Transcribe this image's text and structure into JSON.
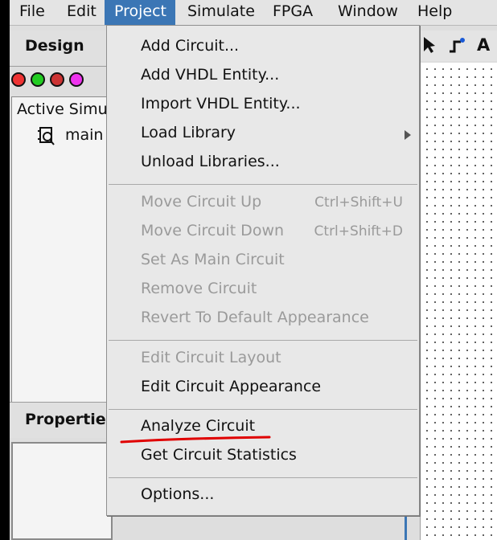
{
  "menubar": {
    "items": [
      "File",
      "Edit",
      "Project",
      "Simulate",
      "FPGA",
      "Window",
      "Help"
    ],
    "active": "Project"
  },
  "design_panel": {
    "title": "Design",
    "tree_root": "Active Simu",
    "tree_child": "main"
  },
  "properties_panel": {
    "title": "Properties"
  },
  "project_menu": {
    "add_circuit": "Add Circuit...",
    "add_vhdl_entity": "Add VHDL Entity...",
    "import_vhdl_entity": "Import VHDL Entity...",
    "load_library": "Load Library",
    "unload_libraries": "Unload Libraries...",
    "move_circuit_up": "Move Circuit Up",
    "move_circuit_up_shortcut": "Ctrl+Shift+U",
    "move_circuit_down": "Move Circuit Down",
    "move_circuit_down_shortcut": "Ctrl+Shift+D",
    "set_as_main_circuit": "Set As Main Circuit",
    "remove_circuit": "Remove Circuit",
    "revert_to_default_appearance": "Revert To Default Appearance",
    "edit_circuit_layout": "Edit Circuit Layout",
    "edit_circuit_appearance": "Edit Circuit Appearance",
    "analyze_circuit": "Analyze Circuit",
    "get_circuit_statistics": "Get Circuit Statistics",
    "options": "Options..."
  },
  "toolbar": {
    "text_tool_label": "A"
  },
  "colors": {
    "menu_highlight": "#3b76b5",
    "disabled_text": "#9a9a9a",
    "annotation_underline": "#e00000"
  },
  "icons": [
    "select-arrow-icon",
    "wire-tool-icon",
    "text-tool-icon",
    "circuit-icon",
    "chevron-right-icon"
  ]
}
